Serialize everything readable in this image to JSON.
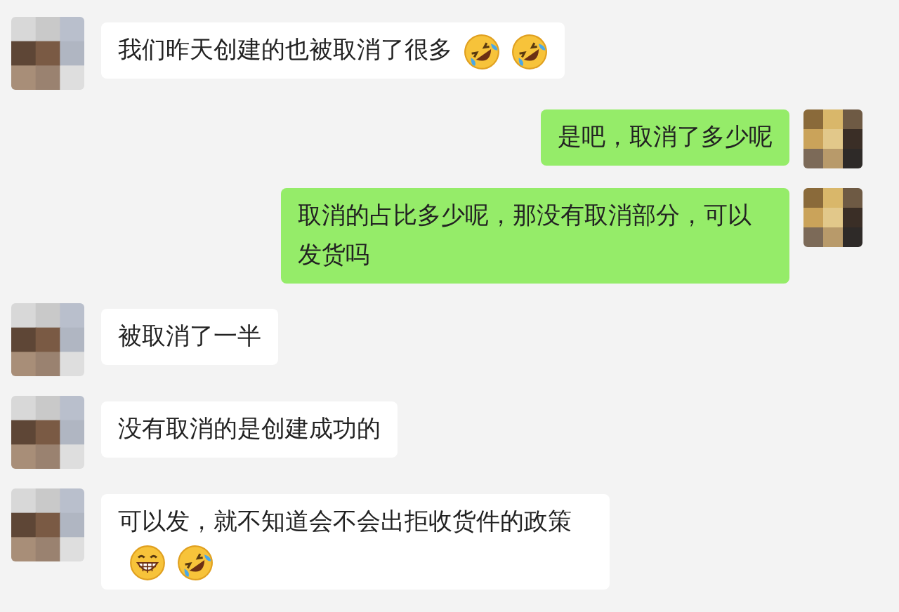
{
  "messages": [
    {
      "kind": "received",
      "text": "我们昨天创建的也被取消了很多",
      "emojis": [
        {
          "kind": "rofl"
        },
        {
          "kind": "rofl"
        }
      ]
    },
    {
      "kind": "sent",
      "text": "是吧，取消了多少呢"
    },
    {
      "kind": "sent",
      "text": "取消的占比多少呢，那没有取消部分，可以发货吗"
    },
    {
      "kind": "received",
      "text": "被取消了一半"
    },
    {
      "kind": "received",
      "text": "没有取消的是创建成功的"
    },
    {
      "kind": "received",
      "text": "可以发，就不知道会不会出拒收货件的政策",
      "emojis": [
        {
          "kind": "grin"
        },
        {
          "kind": "rofl"
        }
      ]
    }
  ]
}
